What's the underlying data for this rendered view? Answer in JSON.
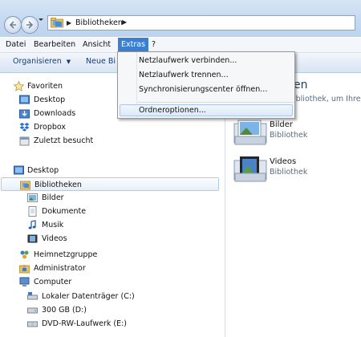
{
  "address": {
    "path": "Bibliotheken"
  },
  "menubar": {
    "items": [
      "Datei",
      "Bearbeiten",
      "Ansicht",
      "Extras",
      "?"
    ],
    "active": "Extras"
  },
  "toolbar": {
    "organize": "Organisieren",
    "new_library": "Neue Bi"
  },
  "extras_menu": {
    "items": [
      "Netzlaufwerk verbinden...",
      "Netzlaufwerk trennen...",
      "Synchronisierungscenter öffnen...",
      "Ordneroptionen..."
    ]
  },
  "navigation": {
    "favorites": {
      "label": "Favoriten",
      "items": [
        "Desktop",
        "Downloads",
        "Dropbox",
        "Zuletzt besucht"
      ]
    },
    "desktop": "Desktop",
    "libraries": {
      "label": "Bibliotheken",
      "items": [
        "Bilder",
        "Dokumente",
        "Musik",
        "Videos"
      ]
    },
    "homegroup": "Heimnetzgruppe",
    "administrator": "Administrator",
    "computer": {
      "label": "Computer",
      "items": [
        "Lokaler Datenträger (C:)",
        "300 GB (D:)",
        "DVD-RW-Laufwerk (E:)"
      ]
    }
  },
  "content": {
    "heading_partial": "en",
    "subheading_partial": "ibliothek, um Ihre D",
    "libraries": [
      {
        "name": "Bilder",
        "type": "Bibliothek",
        "icon": "pictures-library-icon"
      },
      {
        "name": "Videos",
        "type": "Bibliothek",
        "icon": "videos-library-icon"
      }
    ]
  },
  "colors": {
    "menu_highlight": "#3a7fd0",
    "selection_border": "#aecbea",
    "toolbar_text": "#1a3e6a"
  }
}
